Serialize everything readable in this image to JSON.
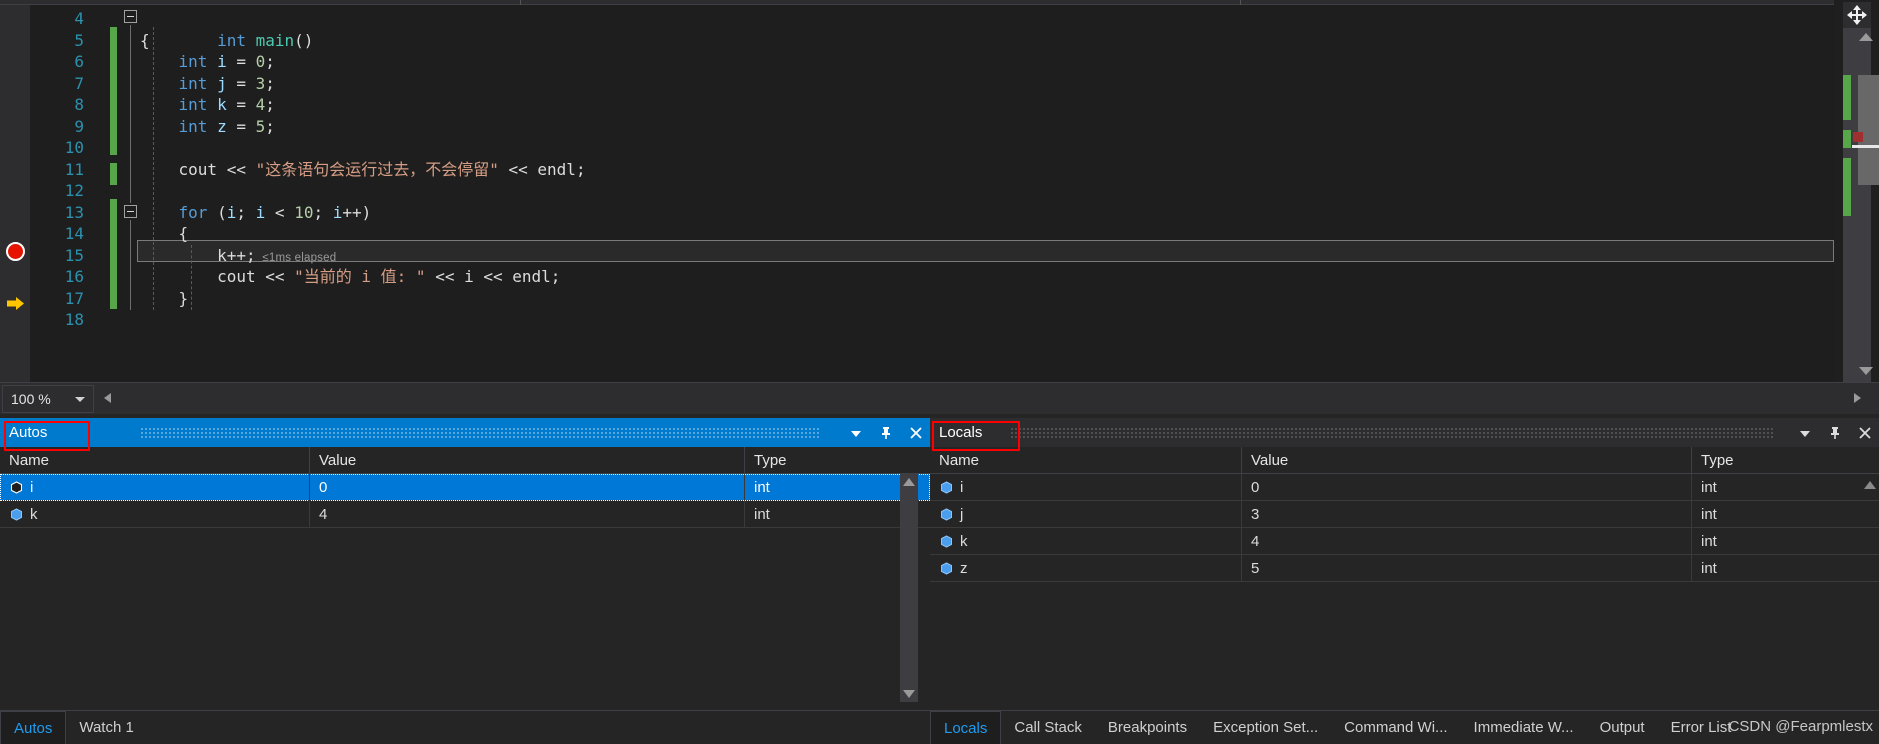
{
  "editor": {
    "zoom_level": "100 %",
    "lines": [
      {
        "num": "4",
        "text": "int main()"
      },
      {
        "num": "5",
        "text": "{"
      },
      {
        "num": "6",
        "text": "    int i = 0;"
      },
      {
        "num": "7",
        "text": "    int j = 3;"
      },
      {
        "num": "8",
        "text": "    int k = 4;"
      },
      {
        "num": "9",
        "text": "    int z = 5;"
      },
      {
        "num": "10",
        "text": ""
      },
      {
        "num": "11",
        "text": "    cout << \"这条语句会运行过去，不会停留\" << endl;"
      },
      {
        "num": "12",
        "text": ""
      },
      {
        "num": "13",
        "text": "    for (i; i < 10; i++)"
      },
      {
        "num": "14",
        "text": "    {"
      },
      {
        "num": "15",
        "text": "        k++;"
      },
      {
        "num": "16",
        "text": "        cout << \"当前的 i 值: \" << i << endl;"
      },
      {
        "num": "17",
        "text": "    }"
      },
      {
        "num": "18",
        "text": ""
      }
    ],
    "elapsed_annotation": "≤1ms elapsed",
    "breakpoint_line": "13",
    "current_line": "15"
  },
  "autos_panel": {
    "title": "Autos",
    "columns": [
      "Name",
      "Value",
      "Type"
    ],
    "rows": [
      {
        "name": "i",
        "value": "0",
        "type": "int",
        "selected": true
      },
      {
        "name": "k",
        "value": "4",
        "type": "int",
        "selected": false
      }
    ],
    "tabs": [
      {
        "label": "Autos",
        "active": true
      },
      {
        "label": "Watch 1",
        "active": false
      }
    ],
    "buttons": {
      "dropdown": "chevron-down",
      "pin": "pin",
      "close": "close"
    }
  },
  "locals_panel": {
    "title": "Locals",
    "columns": [
      "Name",
      "Value",
      "Type"
    ],
    "rows": [
      {
        "name": "i",
        "value": "0",
        "type": "int"
      },
      {
        "name": "j",
        "value": "3",
        "type": "int"
      },
      {
        "name": "k",
        "value": "4",
        "type": "int"
      },
      {
        "name": "z",
        "value": "5",
        "type": "int"
      }
    ],
    "tabs": [
      {
        "label": "Locals",
        "active": true
      },
      {
        "label": "Call Stack",
        "active": false
      },
      {
        "label": "Breakpoints",
        "active": false
      },
      {
        "label": "Exception Set...",
        "active": false
      },
      {
        "label": "Command Wi...",
        "active": false
      },
      {
        "label": "Immediate W...",
        "active": false
      },
      {
        "label": "Output",
        "active": false
      },
      {
        "label": "Error List",
        "active": false
      }
    ],
    "watermark": "CSDN @Fearpmlestx"
  },
  "colors": {
    "accent": "#007acc",
    "selection": "#0078d7",
    "breakpoint": "#e51400",
    "current_line_arrow": "#ffc600",
    "changebar": "#57a64a",
    "highlight_box": "#ff0000",
    "editor_bg": "#1e1e1e",
    "panel_bg": "#252526"
  }
}
